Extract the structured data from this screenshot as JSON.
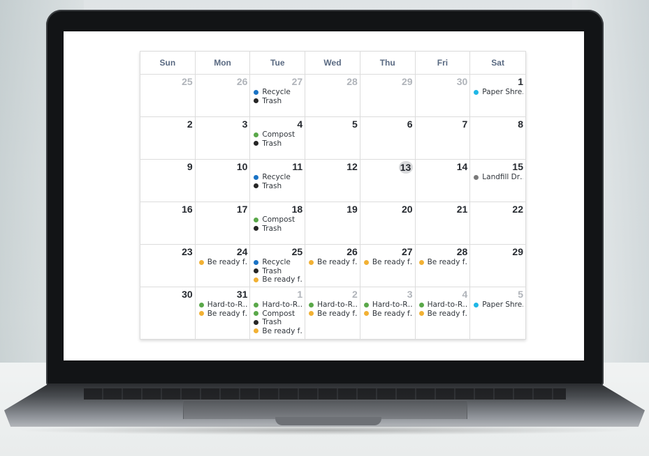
{
  "colors": {
    "recycle": "#1a73c5",
    "trash": "#262626",
    "compost": "#5aa84a",
    "paper": "#1fb7e6",
    "landfill": "#7a7a7a",
    "ready": "#f2b134",
    "hard": "#5aa84a"
  },
  "calendar": {
    "weekdays": [
      "Sun",
      "Mon",
      "Tue",
      "Wed",
      "Thu",
      "Fri",
      "Sat"
    ],
    "weeks": [
      [
        {
          "day": "25",
          "muted": true,
          "events": []
        },
        {
          "day": "26",
          "muted": true,
          "events": []
        },
        {
          "day": "27",
          "muted": true,
          "events": [
            {
              "label": "Recycle",
              "type": "recycle"
            },
            {
              "label": "Trash",
              "type": "trash"
            }
          ]
        },
        {
          "day": "28",
          "muted": true,
          "events": []
        },
        {
          "day": "29",
          "muted": true,
          "events": []
        },
        {
          "day": "30",
          "muted": true,
          "events": []
        },
        {
          "day": "1",
          "events": [
            {
              "label": "Paper Shre…",
              "type": "paper"
            }
          ]
        }
      ],
      [
        {
          "day": "2",
          "events": []
        },
        {
          "day": "3",
          "events": []
        },
        {
          "day": "4",
          "events": [
            {
              "label": "Compost",
              "type": "compost"
            },
            {
              "label": "Trash",
              "type": "trash"
            }
          ]
        },
        {
          "day": "5",
          "events": []
        },
        {
          "day": "6",
          "events": []
        },
        {
          "day": "7",
          "events": []
        },
        {
          "day": "8",
          "events": []
        }
      ],
      [
        {
          "day": "9",
          "events": []
        },
        {
          "day": "10",
          "events": []
        },
        {
          "day": "11",
          "events": [
            {
              "label": "Recycle",
              "type": "recycle"
            },
            {
              "label": "Trash",
              "type": "trash"
            }
          ]
        },
        {
          "day": "12",
          "events": []
        },
        {
          "day": "13",
          "today": true,
          "events": []
        },
        {
          "day": "14",
          "events": []
        },
        {
          "day": "15",
          "events": [
            {
              "label": "Landfill Dr…",
              "type": "landfill"
            }
          ]
        }
      ],
      [
        {
          "day": "16",
          "events": []
        },
        {
          "day": "17",
          "events": []
        },
        {
          "day": "18",
          "events": [
            {
              "label": "Compost",
              "type": "compost"
            },
            {
              "label": "Trash",
              "type": "trash"
            }
          ]
        },
        {
          "day": "19",
          "events": []
        },
        {
          "day": "20",
          "events": []
        },
        {
          "day": "21",
          "events": []
        },
        {
          "day": "22",
          "events": []
        }
      ],
      [
        {
          "day": "23",
          "events": []
        },
        {
          "day": "24",
          "events": [
            {
              "label": "Be ready f…",
              "type": "ready"
            }
          ]
        },
        {
          "day": "25",
          "events": [
            {
              "label": "Recycle",
              "type": "recycle"
            },
            {
              "label": "Trash",
              "type": "trash"
            },
            {
              "label": "Be ready f…",
              "type": "ready"
            }
          ]
        },
        {
          "day": "26",
          "events": [
            {
              "label": "Be ready f…",
              "type": "ready"
            }
          ]
        },
        {
          "day": "27",
          "events": [
            {
              "label": "Be ready f…",
              "type": "ready"
            }
          ]
        },
        {
          "day": "28",
          "events": [
            {
              "label": "Be ready f…",
              "type": "ready"
            }
          ]
        },
        {
          "day": "29",
          "events": []
        }
      ],
      [
        {
          "day": "30",
          "events": []
        },
        {
          "day": "31",
          "events": [
            {
              "label": "Hard-to-R…",
              "type": "hard"
            },
            {
              "label": "Be ready f…",
              "type": "ready"
            }
          ]
        },
        {
          "day": "1",
          "muted": true,
          "events": [
            {
              "label": "Hard-to-R…",
              "type": "hard"
            },
            {
              "label": "Compost",
              "type": "compost"
            },
            {
              "label": "Trash",
              "type": "trash"
            },
            {
              "label": "Be ready f…",
              "type": "ready"
            }
          ]
        },
        {
          "day": "2",
          "muted": true,
          "events": [
            {
              "label": "Hard-to-R…",
              "type": "hard"
            },
            {
              "label": "Be ready f…",
              "type": "ready"
            }
          ]
        },
        {
          "day": "3",
          "muted": true,
          "events": [
            {
              "label": "Hard-to-R…",
              "type": "hard"
            },
            {
              "label": "Be ready f…",
              "type": "ready"
            }
          ]
        },
        {
          "day": "4",
          "muted": true,
          "events": [
            {
              "label": "Hard-to-R…",
              "type": "hard"
            },
            {
              "label": "Be ready f…",
              "type": "ready"
            }
          ]
        },
        {
          "day": "5",
          "muted": true,
          "events": [
            {
              "label": "Paper Shre…",
              "type": "paper"
            }
          ]
        }
      ]
    ]
  }
}
